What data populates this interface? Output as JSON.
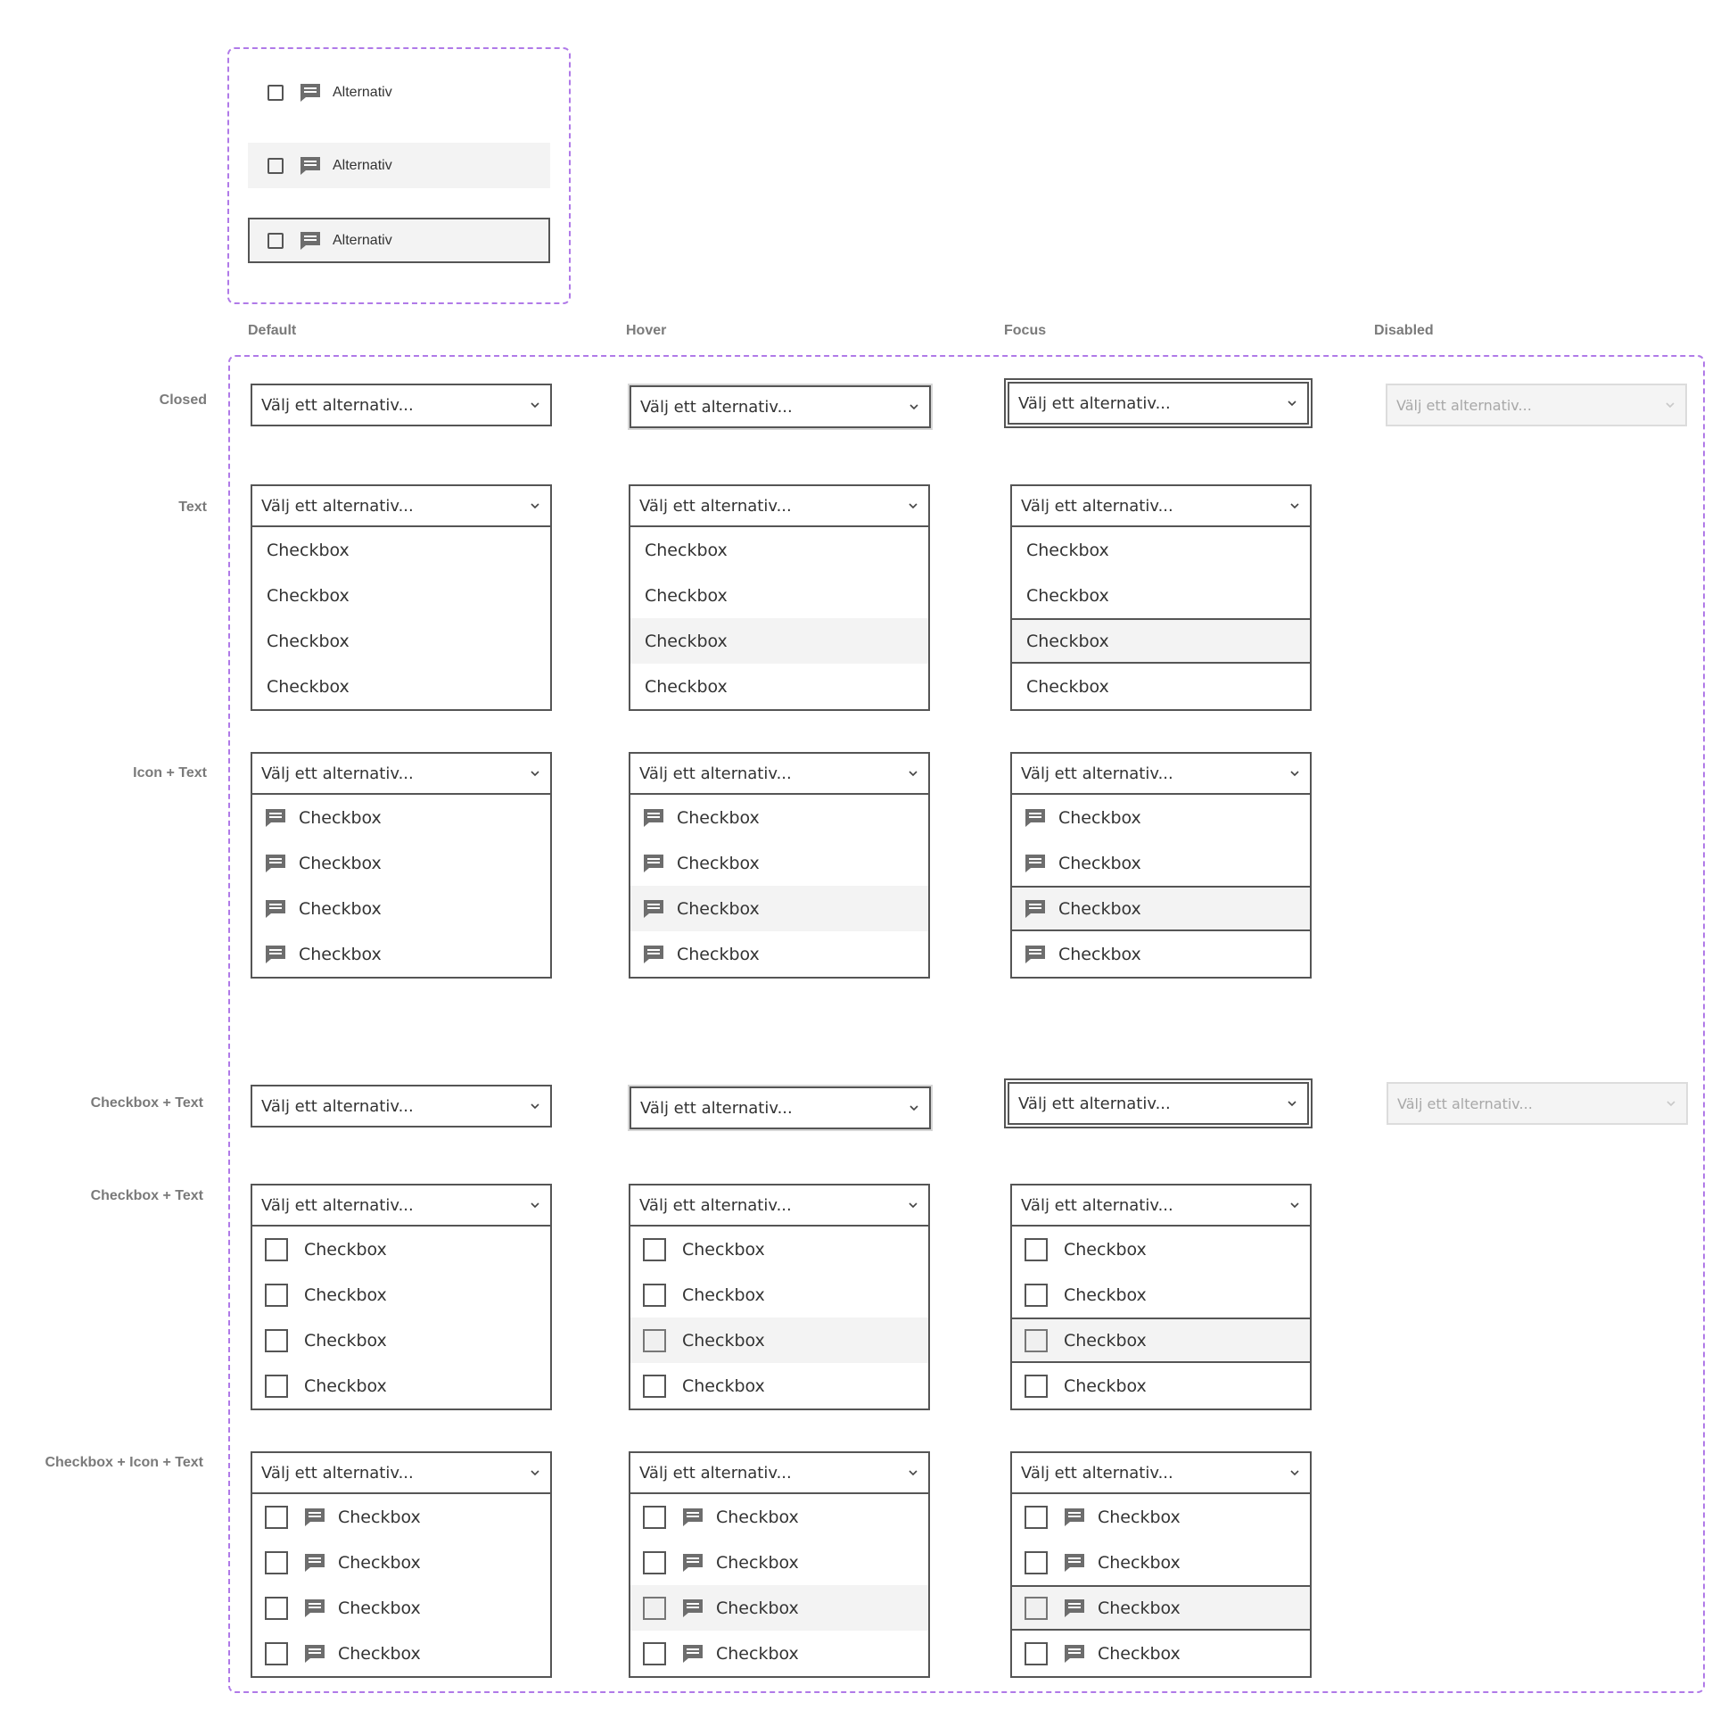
{
  "legend": {
    "options": [
      {
        "label": "Alternativ"
      },
      {
        "label": "Alternativ"
      },
      {
        "label": "Alternativ"
      }
    ]
  },
  "columns": [
    "Default",
    "Hover",
    "Focus",
    "Disabled"
  ],
  "rows": [
    "Closed",
    "Text",
    "Icon + Text",
    "Checkbox + Text",
    "Checkbox + Text",
    "Checkbox + Icon + Text"
  ],
  "select": {
    "placeholder": "Välj ett alternativ...",
    "option_label": "Checkbox"
  },
  "icons": {
    "option_icon": "chat-message-icon",
    "chevron": "chevron-down-icon",
    "checkbox": "checkbox-empty-icon"
  },
  "colors": {
    "frame": "#b07ae8",
    "border": "#555555",
    "highlight": "#f3f3f3",
    "disabled_bg": "#f4f4f4"
  }
}
